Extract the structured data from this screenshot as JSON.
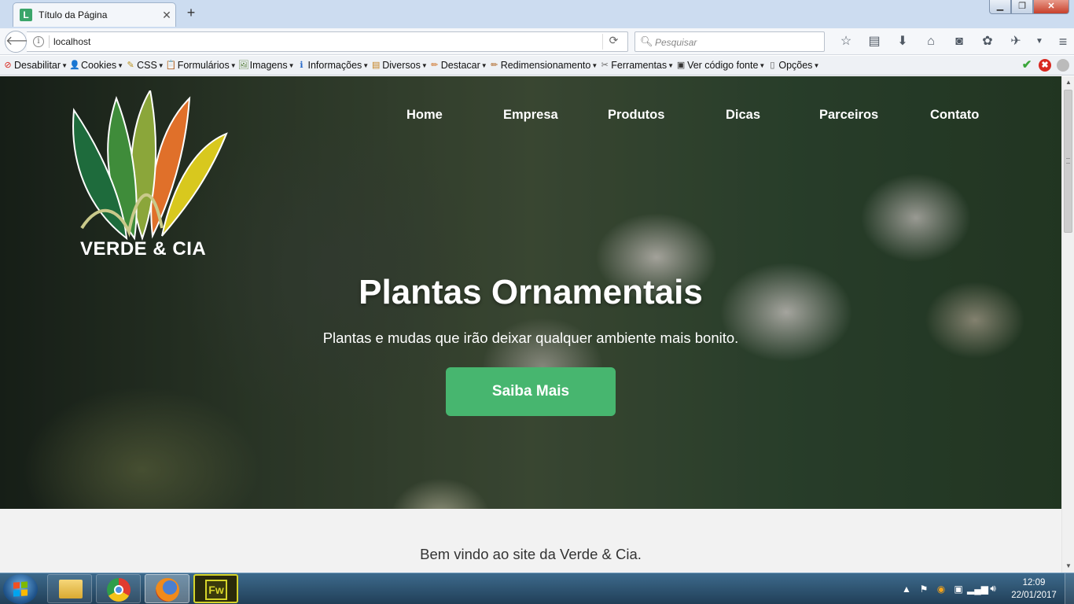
{
  "browser": {
    "tab_title": "Título da Página",
    "tab_favicon": "L",
    "tab_close": "✕",
    "new_tab": "+",
    "url": "localhost",
    "search_placeholder": "Pesquisar",
    "window_controls": {
      "minimize": "▁",
      "maximize": "❐",
      "close": "✕"
    },
    "nav_icons": [
      "bookmark-star-icon",
      "reading-list-icon",
      "download-icon",
      "home-icon",
      "pocket-icon",
      "extension-icon",
      "extension-icon-2",
      "dropdown-icon",
      "menu-icon"
    ]
  },
  "devtoolbar": {
    "items": [
      {
        "label": "Desabilitar",
        "icon": "disable-icon",
        "glyph": "⊘",
        "color": "#d8281f"
      },
      {
        "label": "Cookies",
        "icon": "cookies-icon",
        "glyph": "👤",
        "color": "#222222"
      },
      {
        "label": "CSS",
        "icon": "css-icon",
        "glyph": "✎",
        "color": "#b9911c"
      },
      {
        "label": "Formulários",
        "icon": "forms-icon",
        "glyph": "📋",
        "color": "#c4801f"
      },
      {
        "label": "Imagens",
        "icon": "images-icon",
        "glyph": "🖼",
        "color": "#4f7a32"
      },
      {
        "label": "Informações",
        "icon": "info-icon",
        "glyph": "ℹ",
        "color": "#2467c9"
      },
      {
        "label": "Diversos",
        "icon": "misc-icon",
        "glyph": "▤",
        "color": "#c4801f"
      },
      {
        "label": "Destacar",
        "icon": "highlight-icon",
        "glyph": "✏",
        "color": "#d0762a"
      },
      {
        "label": "Redimensionamento",
        "icon": "resize-icon",
        "glyph": "✏",
        "color": "#b06a2a"
      },
      {
        "label": "Ferramentas",
        "icon": "tools-icon",
        "glyph": "✂",
        "color": "#666666"
      },
      {
        "label": "Ver código fonte",
        "icon": "view-source-icon",
        "glyph": "▣",
        "color": "#333333"
      },
      {
        "label": "Opções",
        "icon": "options-icon",
        "glyph": "▯",
        "color": "#555555"
      }
    ],
    "status_colors": {
      "ok": "#3aa63a",
      "error": "#d8281f",
      "neutral": "#bbbbbb"
    }
  },
  "site": {
    "brand": "VERDE & CIA",
    "nav": [
      "Home",
      "Empresa",
      "Produtos",
      "Dicas",
      "Parceiros",
      "Contato"
    ],
    "hero_title": "Plantas Ornamentais",
    "hero_subtitle": "Plantas e mudas que irão deixar qualquer ambiente mais bonito.",
    "hero_button": "Saiba Mais",
    "welcome": "Bem vindo ao site da Verde & Cia.",
    "colors": {
      "accent": "#47b66f",
      "leaf_dark": "#1e6b3c",
      "leaf_mid": "#3f8c3a",
      "leaf_light": "#8ba63a",
      "leaf_orange": "#e0702a",
      "leaf_yellow": "#d8c81e"
    }
  },
  "taskbar": {
    "apps": [
      "windows-explorer",
      "google-chrome",
      "mozilla-firefox",
      "adobe-fireworks"
    ],
    "fw_label": "Fw",
    "time": "12:09",
    "date": "22/01/2017"
  }
}
